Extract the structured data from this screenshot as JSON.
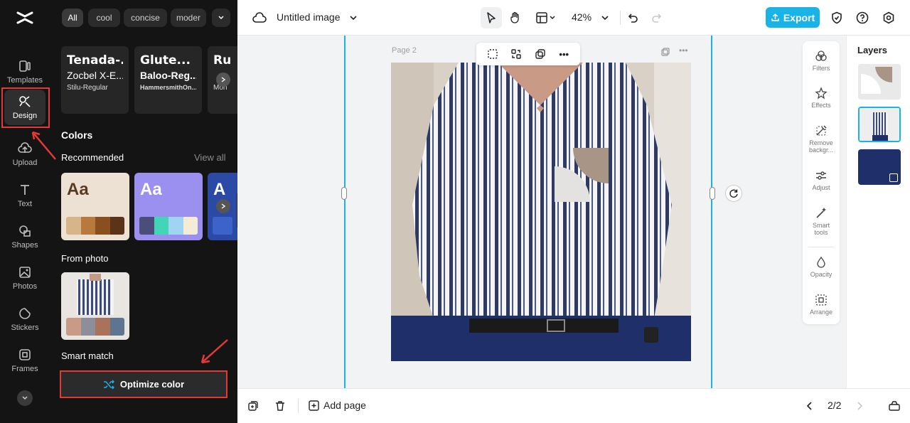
{
  "app": {
    "title": "Untitled image",
    "zoom": "42%",
    "export_label": "Export",
    "brand_color": "#19b3e6"
  },
  "rail": {
    "items": [
      {
        "label": "Templates",
        "icon": "templates-icon"
      },
      {
        "label": "Design",
        "icon": "design-icon"
      },
      {
        "label": "Upload",
        "icon": "upload-icon"
      },
      {
        "label": "Text",
        "icon": "text-icon"
      },
      {
        "label": "Shapes",
        "icon": "shapes-icon"
      },
      {
        "label": "Photos",
        "icon": "photos-icon"
      },
      {
        "label": "Stickers",
        "icon": "stickers-icon"
      },
      {
        "label": "Frames",
        "icon": "frames-icon"
      }
    ]
  },
  "panel": {
    "chips": [
      "All",
      "cool",
      "concise",
      "moder"
    ],
    "font_cards": [
      {
        "line1": "Tenada-...",
        "line2": "Zocbel X-E...",
        "line3": "Stilu-Regular"
      },
      {
        "line1": "Glute...",
        "line2": "Baloo-Reg...",
        "line3": "HammersmithOn..."
      },
      {
        "line1": "Ru",
        "line2": "",
        "line3": "Mon"
      }
    ],
    "colors_title": "Colors",
    "recommended_label": "Recommended",
    "view_all": "View all",
    "palettes": [
      {
        "aa": "Aa",
        "bg": "#ece1d3",
        "fg": "#5a3b22",
        "swatches": [
          "#d7b48a",
          "#b87a3c",
          "#8a4f1f",
          "#5b3318"
        ]
      },
      {
        "aa": "Aa",
        "bg": "#9b8ff0",
        "fg": "#ffffff",
        "swatches": [
          "#4b4d7b",
          "#42d6b6",
          "#9fd4f2",
          "#f4ecd4"
        ]
      },
      {
        "aa": "A",
        "bg": "#2b4aa6",
        "fg": "#ffffff",
        "swatches": [
          "#3c63c9",
          "#3c63c9",
          "#3c63c9",
          "#3c63c9"
        ]
      }
    ],
    "from_photo_label": "From photo",
    "photo_swatches": [
      "#c99b87",
      "#8c8f99",
      "#a8735a",
      "#5d7590"
    ],
    "smart_match_label": "Smart match",
    "optimize_label": "Optimize color"
  },
  "canvas": {
    "page_label": "Page 2"
  },
  "tools": [
    {
      "label": "Filters"
    },
    {
      "label": "Effects"
    },
    {
      "label": "Remove backgr..."
    },
    {
      "label": "Adjust"
    },
    {
      "label": "Smart tools"
    },
    {
      "label": "Opacity"
    },
    {
      "label": "Arrange"
    }
  ],
  "layers": {
    "title": "Layers"
  },
  "bottom": {
    "add_page_label": "Add page",
    "page_count": "2/2"
  }
}
